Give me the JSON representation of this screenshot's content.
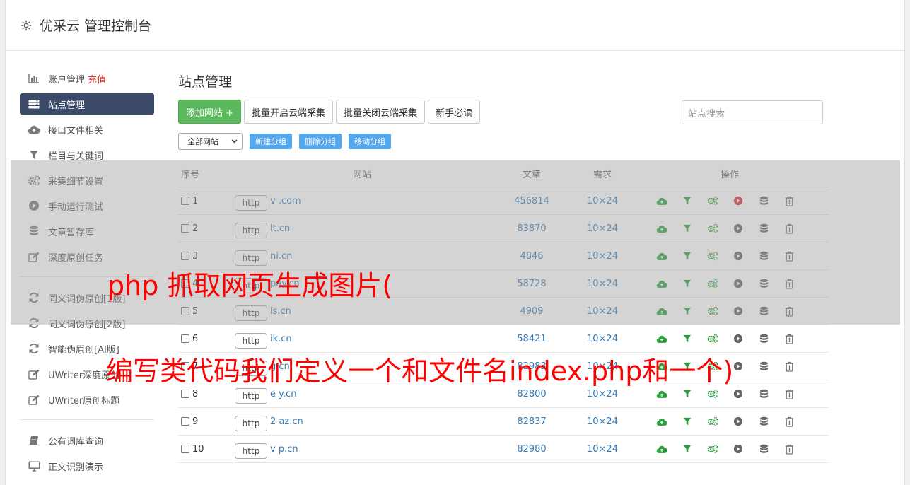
{
  "app": {
    "title": "优采云 管理控制台"
  },
  "sidebar": {
    "group1": [
      {
        "label": "账户管理",
        "extra": "充值",
        "icon": "bar-chart-icon"
      },
      {
        "label": "站点管理",
        "icon": "server-icon",
        "active": true
      },
      {
        "label": "接口文件相关",
        "icon": "cloud-upload-icon"
      },
      {
        "label": "栏目与关键词",
        "icon": "filter-icon"
      },
      {
        "label": "采集细节设置",
        "icon": "cogs-icon"
      },
      {
        "label": "手动运行测试",
        "icon": "play-circle-icon"
      },
      {
        "label": "文章暂存库",
        "icon": "database-icon"
      },
      {
        "label": "深度原创任务",
        "icon": "edit-icon"
      }
    ],
    "group2": [
      {
        "label": "同义词伪原创[1版]",
        "icon": "refresh-icon"
      },
      {
        "label": "同义词伪原创[2版]",
        "icon": "refresh-icon"
      },
      {
        "label": "智能伪原创[AI版]",
        "icon": "refresh-icon"
      },
      {
        "label": "UWriter深度原创",
        "icon": "edit-icon"
      },
      {
        "label": "UWriter原创标题",
        "icon": "edit-icon"
      }
    ],
    "group3": [
      {
        "label": "公有词库查询",
        "icon": "book-icon"
      },
      {
        "label": "正文识别演示",
        "icon": "monitor-icon"
      }
    ]
  },
  "main": {
    "title": "站点管理",
    "toolbar": {
      "add": "添加网站 +",
      "enable_cloud": "批量开启云端采集",
      "disable_cloud": "批量关闭云端采集",
      "guide": "新手必读"
    },
    "search_placeholder": "站点搜索",
    "group_select": "全部网站",
    "group_buttons": {
      "new": "新建分组",
      "delete": "删除分组",
      "move": "移动分组"
    },
    "table": {
      "headers": {
        "no": "序号",
        "site": "网站",
        "articles": "文章",
        "demand": "需求",
        "ops": "操作"
      },
      "rows": [
        {
          "no": "1",
          "prefix": "http",
          "domain": "v .com",
          "articles": "456814",
          "demand": "10×24",
          "running": true
        },
        {
          "no": "2",
          "prefix": "http",
          "domain": "lt.cn",
          "articles": "83870",
          "demand": "10×24",
          "running": false
        },
        {
          "no": "3",
          "prefix": "http",
          "domain": "ni.cn",
          "articles": "4846",
          "demand": "10×24",
          "running": false
        },
        {
          "no": "4",
          "prefix": "http",
          "domain": "pay.cn",
          "articles": "58728",
          "demand": "10×24",
          "running": false
        },
        {
          "no": "5",
          "prefix": "http",
          "domain": "ls.cn",
          "articles": "4909",
          "demand": "10×24",
          "running": false
        },
        {
          "no": "6",
          "prefix": "http",
          "domain": "ik.cn",
          "articles": "58421",
          "demand": "10×24",
          "running": false
        },
        {
          "no": "7",
          "prefix": "http",
          "domain": "g.cn",
          "articles": "82983",
          "demand": "10×24",
          "running": false
        },
        {
          "no": "8",
          "prefix": "http",
          "domain": "e y.cn",
          "articles": "82800",
          "demand": "10×24",
          "running": false
        },
        {
          "no": "9",
          "prefix": "http",
          "domain": "2 az.cn",
          "articles": "82837",
          "demand": "10×24",
          "running": false
        },
        {
          "no": "10",
          "prefix": "http",
          "domain": "v p.cn",
          "articles": "82980",
          "demand": "10×24",
          "running": false
        }
      ]
    }
  },
  "watermark": {
    "line1": "php 抓取网页生成图片(",
    "line2": "编写类代码我们定义一个和文件名index.php和一个)"
  },
  "colors": {
    "accent_green": "#5cb85c",
    "sidebar_active": "#3a4a68",
    "link_blue": "#337ab7",
    "watermark_red": "#ff0000",
    "run_red": "#e03030"
  }
}
